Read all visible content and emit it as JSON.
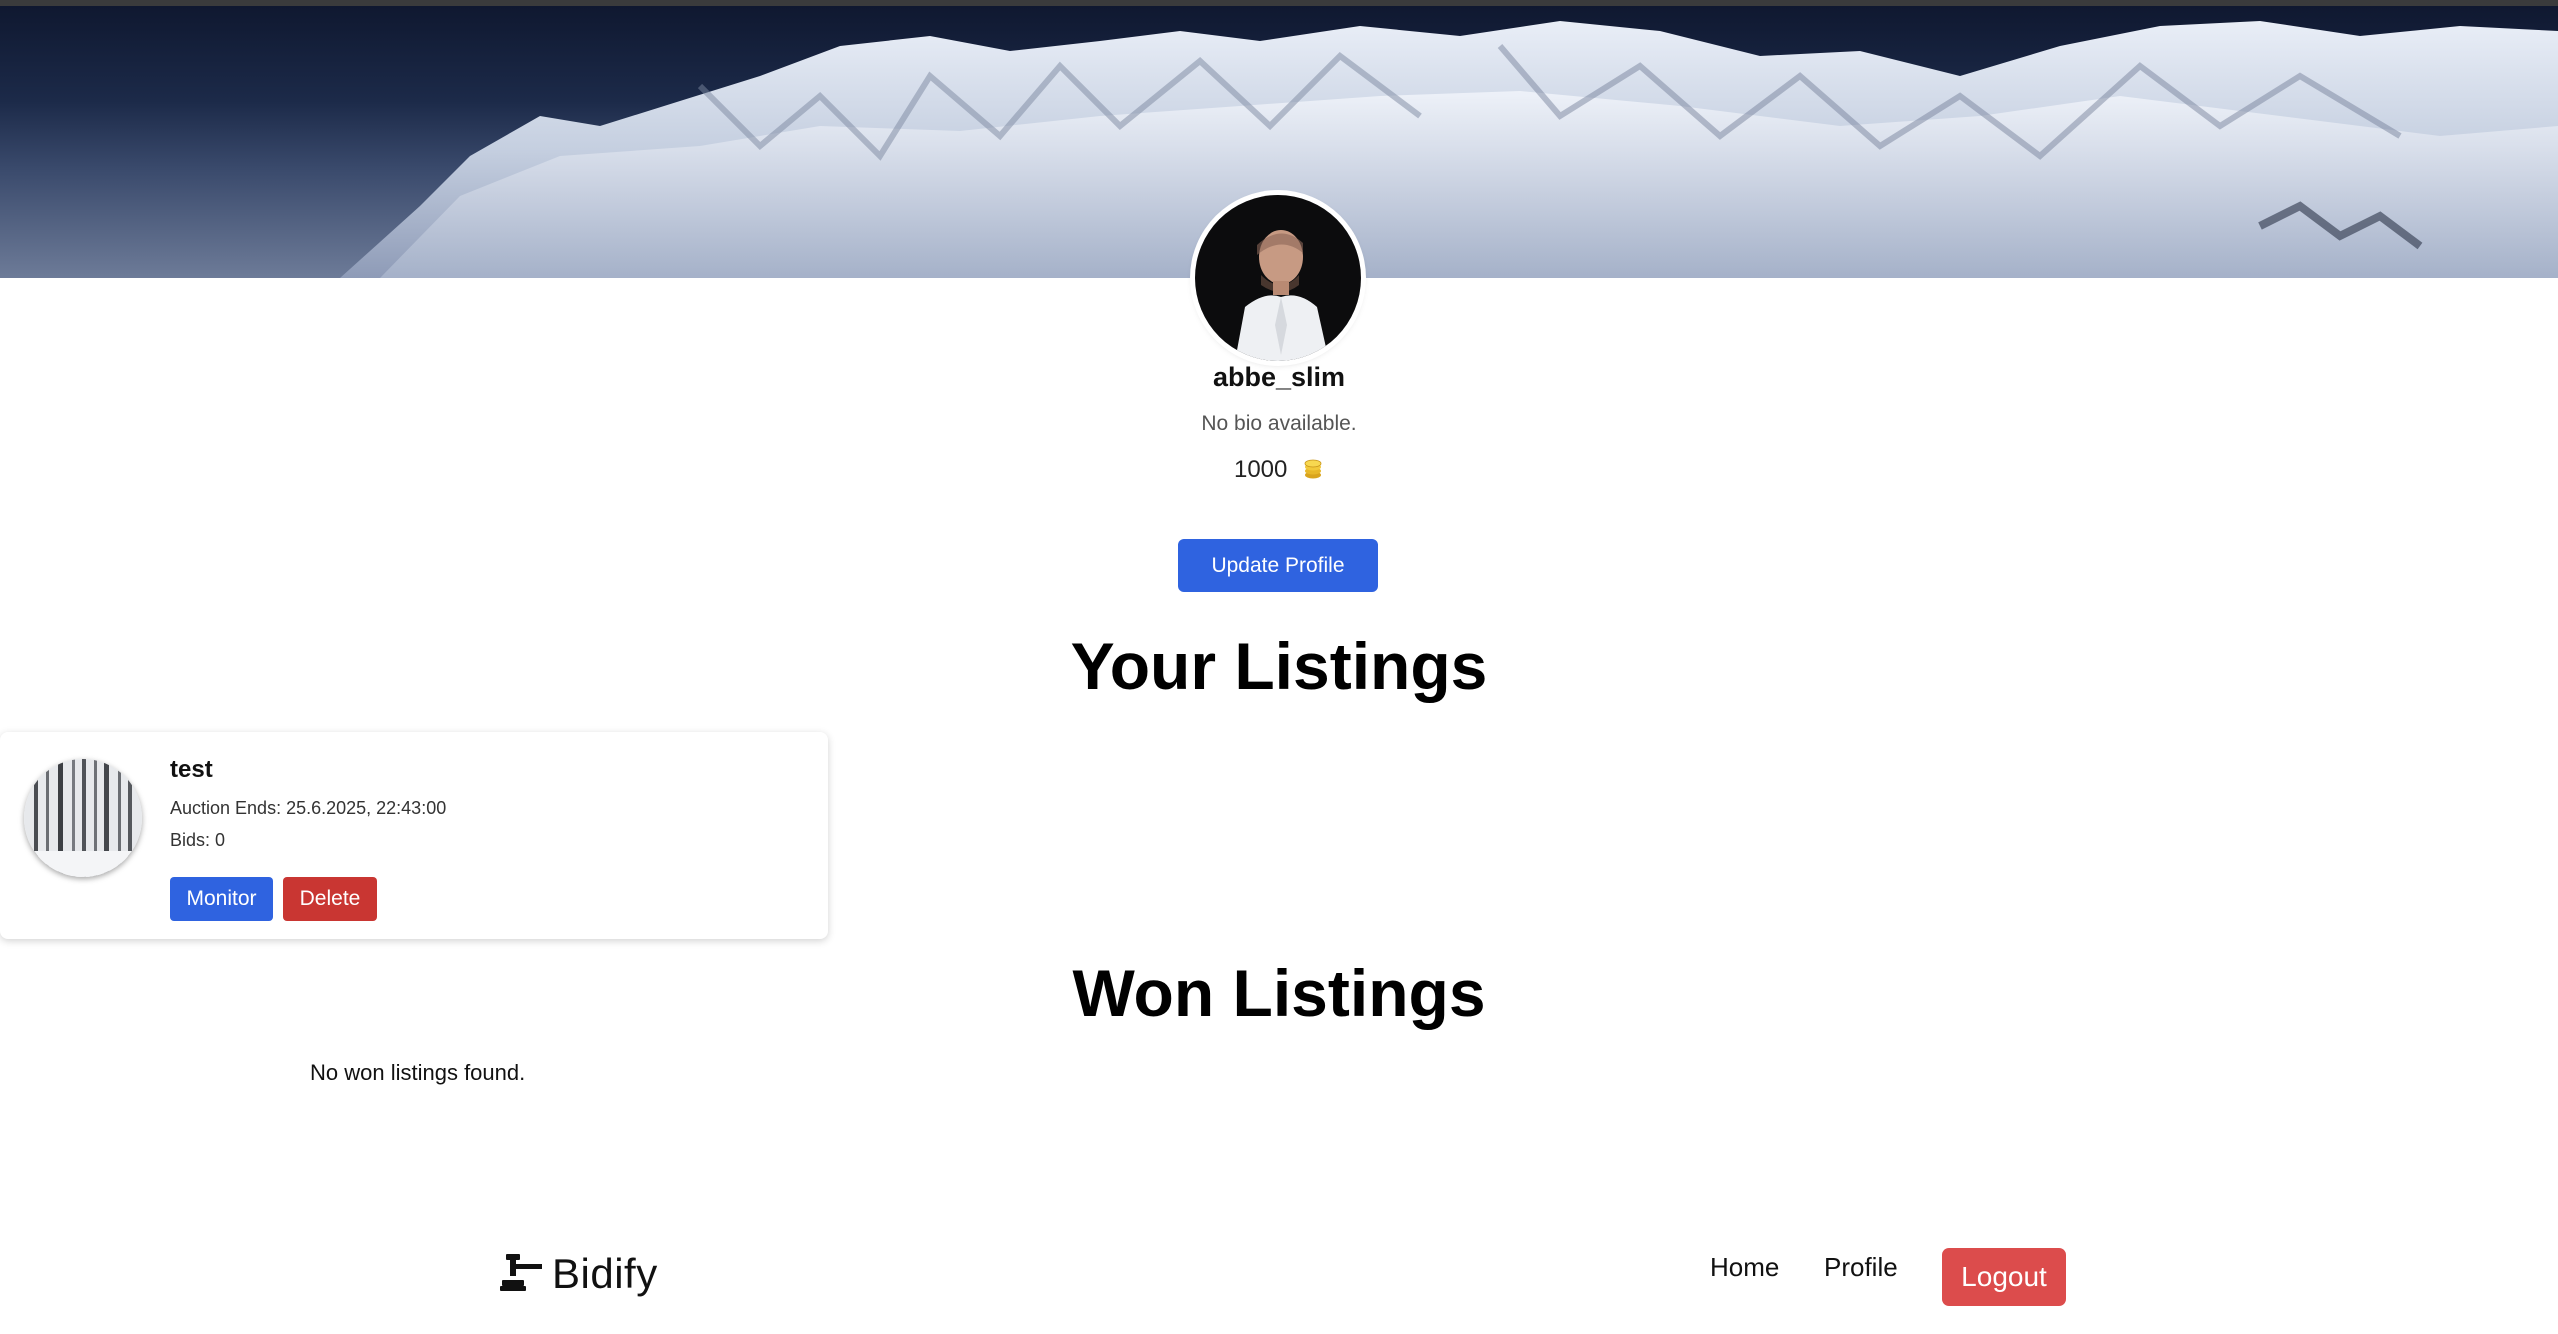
{
  "profile": {
    "username": "abbe_slim",
    "bio": "No bio available.",
    "credits": "1000",
    "update_button": "Update Profile"
  },
  "sections": {
    "listings_title": "Your Listings",
    "won_title": "Won Listings",
    "no_won": "No won listings found."
  },
  "listings": [
    {
      "title": "test",
      "auction_ends": "Auction Ends: 25.6.2025, 22:43:00",
      "bids": "Bids: 0",
      "monitor_label": "Monitor",
      "delete_label": "Delete"
    }
  ],
  "footer": {
    "logo_text": "Bidify",
    "nav_home": "Home",
    "nav_profile": "Profile",
    "logout_label": "Logout"
  },
  "colors": {
    "primary": "#2f63e0",
    "danger": "#c93632",
    "logout": "#dc4c4c"
  },
  "icons": [
    "coins-icon",
    "gavel-logo-icon"
  ]
}
